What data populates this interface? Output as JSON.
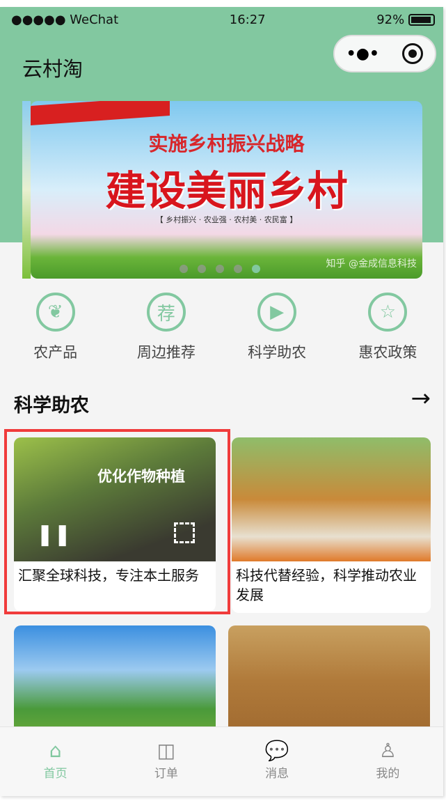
{
  "status": {
    "carrier": "●●●●● WeChat",
    "time": "16:27",
    "battery": "92%"
  },
  "header": {
    "title": "云村淘"
  },
  "banner": {
    "line1": "实施乡村振兴战略",
    "line2": "建设美丽乡村",
    "line3": "【 乡村振兴 · 农业强 · 农村美 · 农民富 】",
    "watermark": "知乎 @金成信息科技",
    "active_index": 4,
    "count": 5
  },
  "categories": [
    {
      "label": "农产品",
      "icon": "leaf-search-icon"
    },
    {
      "label": "周边推荐",
      "icon": "recommend-icon"
    },
    {
      "label": "科学助农",
      "icon": "video-camera-icon"
    },
    {
      "label": "惠农政策",
      "icon": "star-icon"
    }
  ],
  "categories_glyphs": [
    "❦",
    "荐",
    "▶",
    "☆"
  ],
  "section": {
    "title": "科学助农",
    "more": "→"
  },
  "cards": [
    {
      "caption": "汇聚全球科技，专注本土服务",
      "overlay": "优化作物种植"
    },
    {
      "caption": "科技代替经验，科学推动农业发展"
    }
  ],
  "tabs": [
    {
      "label": "首页",
      "glyph": "⌂"
    },
    {
      "label": "订单",
      "glyph": "◫"
    },
    {
      "label": "消息",
      "glyph": "💬"
    },
    {
      "label": "我的",
      "glyph": "♙"
    }
  ],
  "colors": {
    "accent": "#82c8a0",
    "highlight": "#f03b3b"
  }
}
